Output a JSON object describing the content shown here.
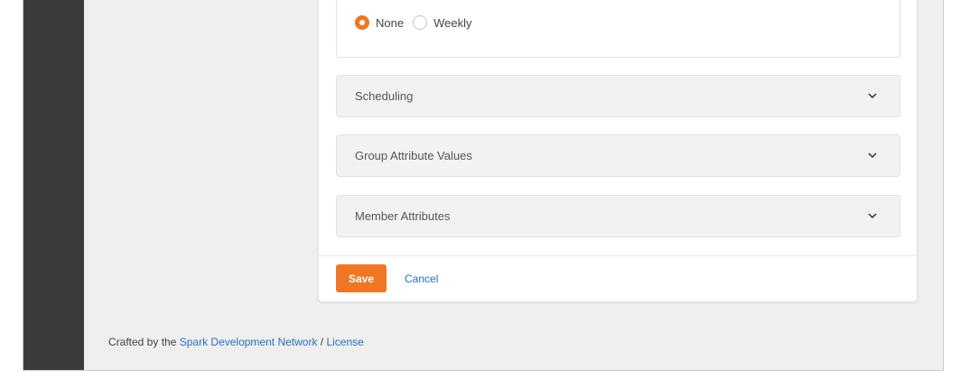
{
  "notification": {
    "options": [
      {
        "label": "None",
        "selected": true
      },
      {
        "label": "Weekly",
        "selected": false
      }
    ]
  },
  "panels": [
    {
      "title": "Scheduling",
      "icon": "chevron-down-icon"
    },
    {
      "title": "Group Attribute Values",
      "icon": "chevron-down-icon"
    },
    {
      "title": "Member Attributes",
      "icon": "chevron-down-icon"
    }
  ],
  "actions": {
    "save_label": "Save",
    "cancel_label": "Cancel"
  },
  "footer": {
    "prefix": "Crafted by the ",
    "org_link": "Spark Development Network",
    "separator": " / ",
    "license_link": "License"
  },
  "colors": {
    "accent": "#ee7625",
    "link": "#2e6fb5",
    "sidebar": "#3b3b3b",
    "page_bg": "#efefef"
  }
}
